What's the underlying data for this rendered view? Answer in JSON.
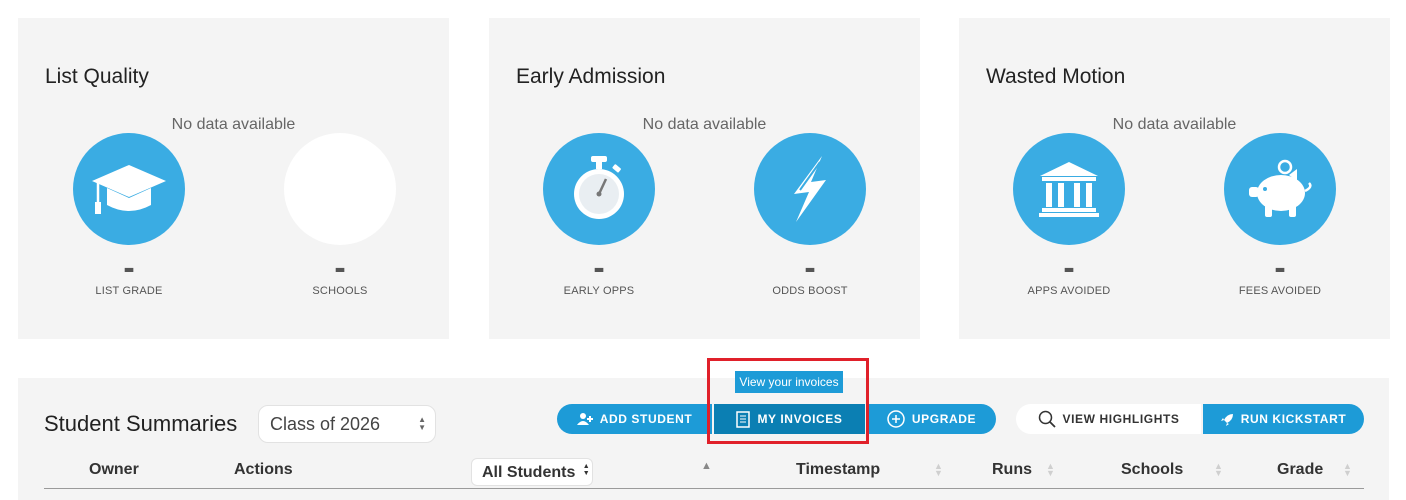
{
  "cards": [
    {
      "title": "List Quality",
      "no_data": "No data available",
      "metrics": [
        {
          "icon": "graduation-cap-icon",
          "value": "-",
          "label": "LIST GRADE"
        },
        {
          "icon": "blank",
          "value": "-",
          "label": "SCHOOLS"
        }
      ]
    },
    {
      "title": "Early Admission",
      "no_data": "No data available",
      "metrics": [
        {
          "icon": "stopwatch-icon",
          "value": "-",
          "label": "EARLY OPPS"
        },
        {
          "icon": "lightning-icon",
          "value": "-",
          "label": "ODDS BOOST"
        }
      ]
    },
    {
      "title": "Wasted Motion",
      "no_data": "No data available",
      "metrics": [
        {
          "icon": "bank-icon",
          "value": "-",
          "label": "APPS AVOIDED"
        },
        {
          "icon": "piggy-bank-icon",
          "value": "-",
          "label": "FEES AVOIDED"
        }
      ]
    }
  ],
  "summaries": {
    "title": "Student Summaries",
    "class_select": "Class of 2026",
    "tooltip": "View your invoices",
    "buttons": {
      "add_student": "ADD STUDENT",
      "my_invoices": "MY INVOICES",
      "upgrade": "UPGRADE",
      "view_highlights": "VIEW HIGHLIGHTS",
      "run_kickstart": "RUN KICKSTART"
    },
    "columns": {
      "owner": "Owner",
      "actions": "Actions",
      "filter": "All Students",
      "timestamp": "Timestamp",
      "runs": "Runs",
      "schools": "Schools",
      "grade": "Grade"
    }
  },
  "colors": {
    "accent": "#1d9bd7",
    "accent_active": "#0b7fb3",
    "icon_circle": "#3aace3",
    "highlight": "#e0202a",
    "panel": "#f4f4f4"
  }
}
